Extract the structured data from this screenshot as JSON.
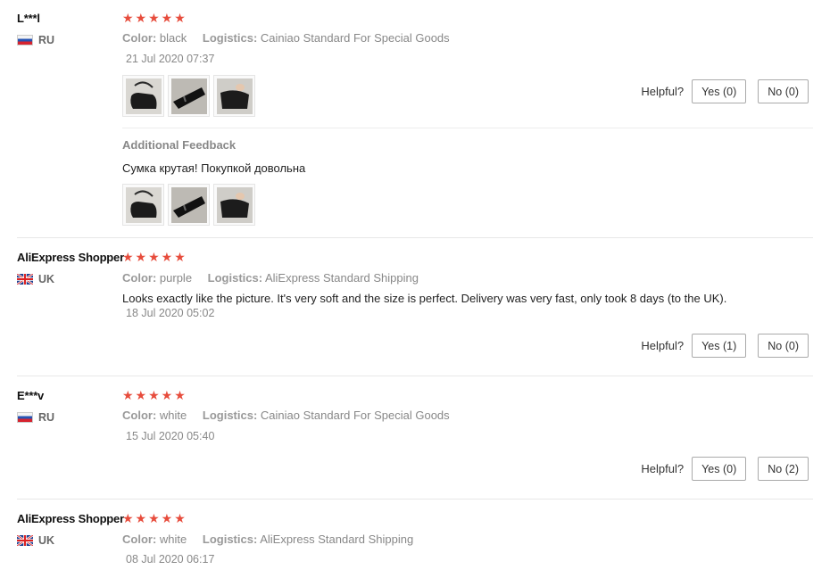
{
  "reviews": [
    {
      "user": "L***l",
      "country": "RU",
      "stars": "★★★★★",
      "color_label": "Color:",
      "color_value": "black",
      "logistics_label": "Logistics:",
      "logistics_value": "Cainiao Standard For Special Goods",
      "date": "21 Jul 2020 07:37",
      "helpful_label": "Helpful?",
      "yes": "Yes (0)",
      "no": "No (0)",
      "additional_title": "Additional Feedback",
      "additional_text": "Сумка крутая! Покупкой довольна"
    },
    {
      "user": "AliExpress Shopper",
      "country": "UK",
      "stars": "★★★★★",
      "color_label": "Color:",
      "color_value": "purple",
      "logistics_label": "Logistics:",
      "logistics_value": "AliExpress Standard Shipping",
      "text": "Looks exactly like the picture. It's very soft and the size is perfect. Delivery was very fast, only took 8 days (to the UK).",
      "date": "18 Jul 2020 05:02",
      "helpful_label": "Helpful?",
      "yes": "Yes (1)",
      "no": "No (0)"
    },
    {
      "user": "E***v",
      "country": "RU",
      "stars": "★★★★★",
      "color_label": "Color:",
      "color_value": "white",
      "logistics_label": "Logistics:",
      "logistics_value": "Cainiao Standard For Special Goods",
      "date": "15 Jul 2020 05:40",
      "helpful_label": "Helpful?",
      "yes": "Yes (0)",
      "no": "No (2)"
    },
    {
      "user": "AliExpress Shopper",
      "country": "UK",
      "stars": "★★★★★",
      "color_label": "Color:",
      "color_value": "white",
      "logistics_label": "Logistics:",
      "logistics_value": "AliExpress Standard Shipping",
      "date": "08 Jul 2020 06:17"
    }
  ],
  "colors": {
    "star": "#e74c3c",
    "muted": "#999999",
    "border": "#e8e8e8"
  }
}
